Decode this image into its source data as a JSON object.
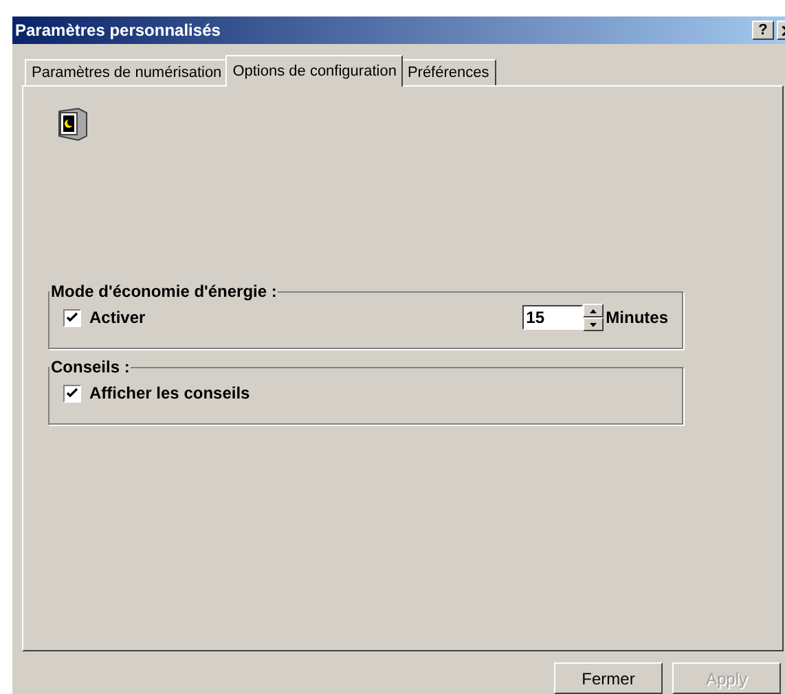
{
  "window": {
    "title": "Paramètres personnalisés",
    "help": "?"
  },
  "tabs": [
    {
      "label": "Paramètres de numérisation",
      "selected": false
    },
    {
      "label": "Options de configuration",
      "selected": true
    },
    {
      "label": "Préférences",
      "selected": false
    }
  ],
  "power_group": {
    "title": "Mode d'économie d'énergie :",
    "checkbox": {
      "label": "Activer",
      "checked": true
    },
    "spinner": {
      "value": "15",
      "unit": "Minutes"
    }
  },
  "tips_group": {
    "title": "Conseils :",
    "checkbox": {
      "label": "Afficher les conseils",
      "checked": true
    }
  },
  "buttons": [
    {
      "label": "Fermer",
      "disabled": false
    },
    {
      "label": "Apply",
      "disabled": true
    }
  ]
}
